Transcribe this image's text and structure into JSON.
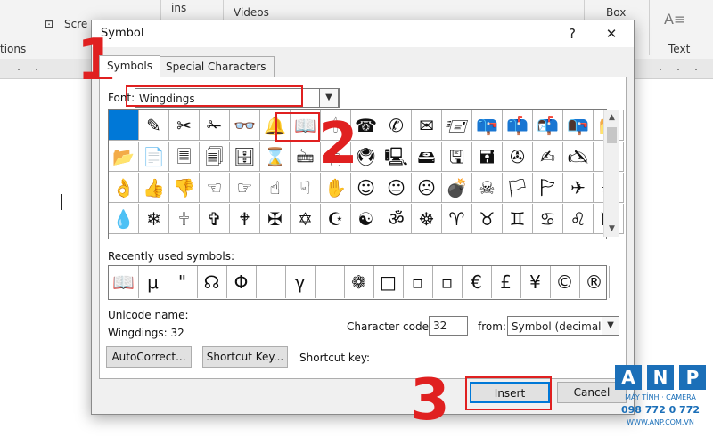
{
  "ribbon": {
    "items": [
      "Scre",
      "ins",
      "Videos",
      "Box",
      "Text",
      "tions"
    ],
    "chevron": "⌄"
  },
  "dialog": {
    "title": "Symbol",
    "help": "?",
    "close": "✕",
    "tabs": [
      "Symbols",
      "Special Characters"
    ],
    "font_label": "Font:",
    "font_value": "Wingdings",
    "recent_label": "Recently used symbols:",
    "unicode_name_label": "Unicode name:",
    "unicode_name_value": "Wingdings: 32",
    "char_code_label": "Character code:",
    "char_code_value": "32",
    "from_label": "from:",
    "from_value": "Symbol (decimal)",
    "autocorrect_label": "AutoCorrect...",
    "shortcut_key_button": "Shortcut Key...",
    "shortcut_key_label": "Shortcut key:",
    "insert_label": "Insert",
    "cancel_label": "Cancel"
  },
  "symbols": [
    [
      "",
      "✎",
      "✂",
      "✁",
      "👓",
      "🔔",
      "📖",
      "🕯",
      "☎",
      "✆",
      "✉",
      "🖅",
      "📪",
      "📫",
      "📬",
      "📭",
      "📁"
    ],
    [
      "📂",
      "📄",
      "🗏",
      "🗐",
      "🗄",
      "⌛",
      "🖮",
      "🖰",
      "🖲",
      "🖳",
      "🖴",
      "🖫",
      "🖬",
      "✇",
      "✍",
      "🖎",
      "✌"
    ],
    [
      "👌",
      "👍",
      "👎",
      "☜",
      "☞",
      "☝",
      "☟",
      "✋",
      "☺",
      "😐",
      "☹",
      "💣",
      "☠",
      "🏳",
      "🏱",
      "✈",
      "☼"
    ],
    [
      "💧",
      "❄",
      "🕆",
      "✞",
      "🕈",
      "✠",
      "✡",
      "☪",
      "☯",
      "ॐ",
      "☸",
      "♈",
      "♉",
      "♊",
      "♋",
      "♌",
      "♍"
    ]
  ],
  "recent_symbols": [
    "📖",
    "μ",
    "\"",
    "☊",
    "Φ",
    "",
    "γ",
    "",
    "❁",
    "□",
    "▫",
    "▫",
    "€",
    "£",
    "¥",
    "©",
    "®"
  ],
  "annotations": [
    "1",
    "2",
    "3"
  ],
  "watermark": {
    "letters": [
      "A",
      "N",
      "P"
    ],
    "line1": "MÁY TÍNH · CAMERA",
    "line2": "098 772 0 772",
    "line3": "WWW.ANP.COM.VN"
  },
  "colors": {
    "accent": "#0078d7",
    "annotation": "#e02020",
    "brand": "#1b6fb8"
  }
}
